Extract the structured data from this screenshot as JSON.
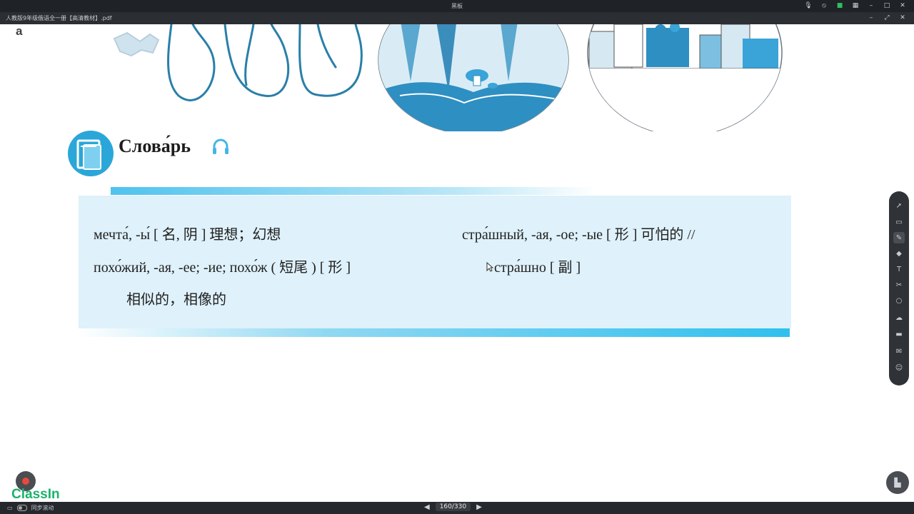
{
  "window": {
    "title": "黑板",
    "document_name": "人教版9年级俄语全一册【高清教材】.pdf"
  },
  "watermark": "a",
  "vocabulary": {
    "title": "Слова́рь",
    "entries": [
      {
        "text": "мечта́, -ы́ [ 名, 阴 ] 理想；幻想"
      },
      {
        "text": "похо́жий, -ая, -ее; -ие; похо́ж ( 短尾 ) [ 形 ]"
      },
      {
        "text": "相似的，相像的"
      },
      {
        "text": "стра́шный, -ая, -ое; -ые [ 形 ] 可怕的 //"
      },
      {
        "text": "стра́шно [ 副 ]"
      }
    ]
  },
  "logo": {
    "text": "ClassIn"
  },
  "bottombar": {
    "sync_label": "同步滚动",
    "page": "160",
    "total": "/330"
  },
  "icons": {
    "titlebar": [
      "mic-icon",
      "camera-off-icon",
      "video-icon",
      "grid-icon",
      "minimize-icon",
      "maximize-icon",
      "close-icon"
    ],
    "palette": [
      "select-icon",
      "window-icon",
      "pen-icon",
      "eraser-icon",
      "text-icon",
      "scissors-icon",
      "shape-icon",
      "cloud-icon",
      "folder-icon",
      "chat-icon",
      "users-icon"
    ]
  },
  "colors": {
    "accent": "#2aa7d8",
    "box_bg": "#dff1fa",
    "classin_green": "#1bb26b"
  }
}
